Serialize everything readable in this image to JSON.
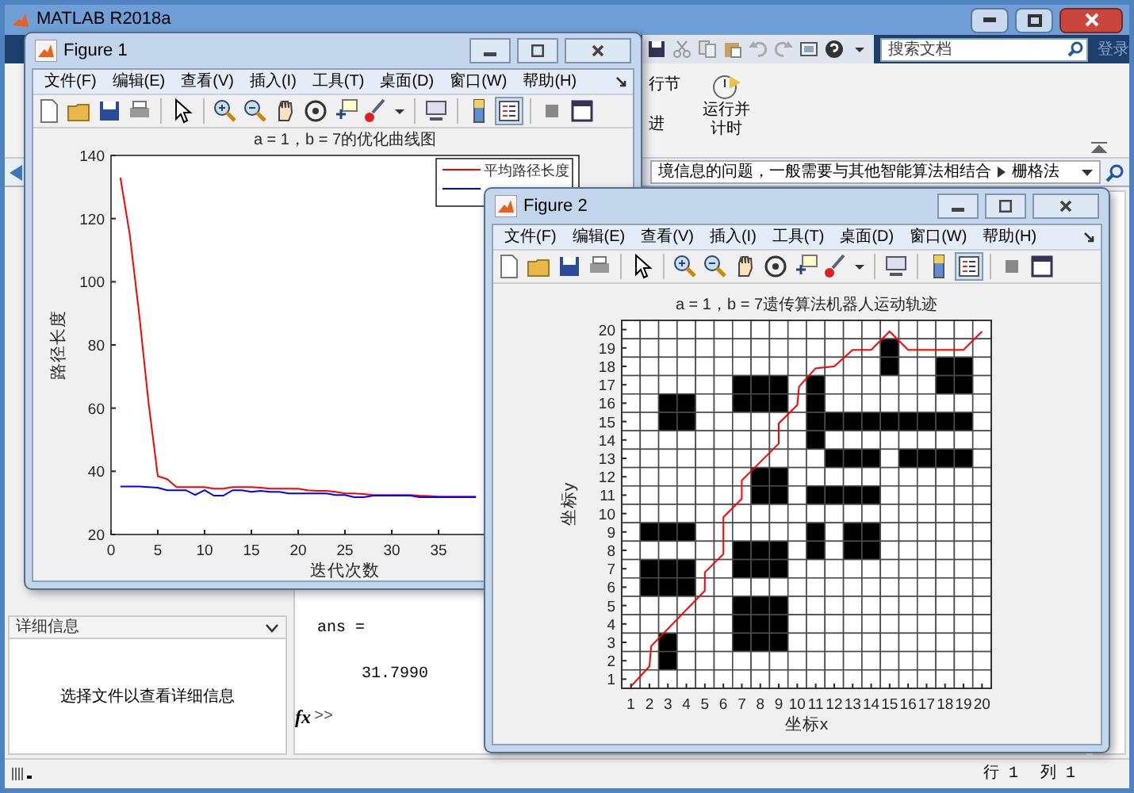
{
  "main_window": {
    "title": "MATLAB R2018a",
    "search": {
      "placeholder": "搜索文档"
    },
    "sign_in": "登录",
    "ribbon_buttons": [
      {
        "label": "行节"
      },
      {
        "label": "进"
      },
      {
        "label": "运行并计时"
      }
    ],
    "address_bar": {
      "path": "境信息的问题，一般需要与其他智能算法相结合",
      "folder": "栅格法"
    },
    "details_panel": {
      "title": "详细信息",
      "message": "选择文件以查看详细信息"
    },
    "command_window": {
      "lines": [
        "ans =",
        "31.7990"
      ],
      "fx_label": "fx",
      "prompt": ">>"
    },
    "status_bar": {
      "row": "行 1",
      "column": "列 1"
    }
  },
  "figures": [
    {
      "title": "Figure 1",
      "menu": [
        "文件(F)",
        "编辑(E)",
        "查看(V)",
        "插入(I)",
        "工具(T)",
        "桌面(D)",
        "窗口(W)",
        "帮助(H)"
      ],
      "chart_data": {
        "type": "line",
        "title": "a = 1，b = 7的优化曲线图",
        "xlabel": "迭代次数",
        "ylabel": "路径长度",
        "xlim": [
          0,
          50
        ],
        "ylim": [
          20,
          140
        ],
        "xticks": [
          0,
          5,
          10,
          15,
          20,
          25,
          30,
          35
        ],
        "yticks": [
          20,
          40,
          60,
          80,
          100,
          120,
          140
        ],
        "x": [
          1,
          2,
          3,
          4,
          5,
          6,
          7,
          8,
          9,
          10,
          11,
          12,
          13,
          14,
          15,
          16,
          17,
          18,
          19,
          20,
          21,
          22,
          23,
          24,
          25,
          26,
          27,
          28,
          29,
          30,
          31,
          32,
          33,
          34,
          35,
          36,
          37,
          38,
          39
        ],
        "series": [
          {
            "name": "平均路径长度",
            "color": "#ff0000",
            "values": [
              133,
              115,
              90,
              62,
              38.5,
              37.5,
              35,
              35,
              35,
              35,
              34.5,
              34.5,
              35,
              35,
              35,
              34.8,
              34.5,
              34.5,
              34.5,
              34.5,
              34,
              33.8,
              33.8,
              33.5,
              33,
              33,
              32.8,
              32.5,
              32.5,
              32.5,
              32.5,
              32.5,
              32.3,
              32.2,
              32,
              32,
              32,
              32,
              32
            ]
          },
          {
            "color": "#0000ff",
            "values": [
              35.2,
              35.2,
              35.2,
              35,
              34.8,
              34,
              34,
              34,
              32.5,
              34,
              32.3,
              32.3,
              34,
              34,
              33.5,
              33.8,
              33.5,
              33.5,
              33,
              33,
              33,
              33,
              33,
              32.5,
              32.5,
              31.8,
              31.8,
              32.3,
              32.3,
              32.3,
              32.3,
              32.3,
              31.8,
              31.8,
              31.8,
              31.8,
              31.8,
              31.8,
              31.8
            ]
          }
        ]
      }
    },
    {
      "title": "Figure 2",
      "menu": [
        "文件(F)",
        "编辑(E)",
        "查看(V)",
        "插入(I)",
        "工具(T)",
        "桌面(D)",
        "窗口(W)",
        "帮助(H)"
      ],
      "chart_data": {
        "type": "line",
        "title": "a = 1，b = 7遗传算法机器人运动轨迹",
        "xlabel": "坐标x",
        "ylabel": "坐标y",
        "xlim": [
          0.5,
          20.5
        ],
        "ylim": [
          0.5,
          20.5
        ],
        "xticks": [
          1,
          2,
          3,
          4,
          5,
          6,
          7,
          8,
          9,
          10,
          11,
          12,
          13,
          14,
          15,
          16,
          17,
          18,
          19,
          20
        ],
        "yticks": [
          1,
          2,
          3,
          4,
          5,
          6,
          7,
          8,
          9,
          10,
          11,
          12,
          13,
          14,
          15,
          16,
          17,
          18,
          19,
          20
        ],
        "x": [
          1,
          2,
          2.1,
          4.6,
          5,
          5,
          6,
          6,
          7,
          7,
          8,
          9,
          9,
          10,
          10.1,
          11,
          12,
          13,
          14,
          15,
          16,
          19,
          20
        ],
        "series": [
          {
            "color": "#ff0000",
            "values": [
              0.6,
              1.7,
              2.8,
              5.4,
              5.8,
              6.8,
              7.8,
              9.8,
              10.8,
              11.8,
              12.8,
              13.8,
              14.9,
              15.9,
              16.9,
              17.9,
              18,
              18.9,
              18.9,
              19.9,
              18.9,
              18.9,
              19.9
            ]
          }
        ]
      },
      "obstacle_rows": [
        [
          false,
          false,
          false,
          false,
          false,
          false,
          false,
          false,
          false,
          false,
          false,
          false,
          false,
          false,
          false,
          false,
          false,
          false,
          false,
          false
        ],
        [
          false,
          false,
          false,
          false,
          false,
          false,
          false,
          false,
          false,
          false,
          false,
          false,
          false,
          false,
          true,
          false,
          false,
          false,
          false,
          false
        ],
        [
          false,
          false,
          false,
          false,
          false,
          false,
          false,
          false,
          false,
          false,
          false,
          false,
          false,
          false,
          true,
          false,
          false,
          true,
          true,
          false
        ],
        [
          false,
          false,
          false,
          false,
          false,
          false,
          true,
          true,
          true,
          false,
          true,
          false,
          false,
          false,
          false,
          false,
          false,
          true,
          true,
          false
        ],
        [
          false,
          false,
          true,
          true,
          false,
          false,
          true,
          true,
          true,
          false,
          true,
          false,
          false,
          false,
          false,
          false,
          false,
          false,
          false,
          false
        ],
        [
          false,
          false,
          true,
          true,
          false,
          false,
          false,
          false,
          false,
          false,
          true,
          true,
          true,
          true,
          true,
          true,
          true,
          true,
          true,
          false
        ],
        [
          false,
          false,
          false,
          false,
          false,
          false,
          false,
          false,
          false,
          false,
          true,
          false,
          false,
          false,
          false,
          false,
          false,
          false,
          false,
          false
        ],
        [
          false,
          false,
          false,
          false,
          false,
          false,
          false,
          false,
          false,
          false,
          false,
          true,
          true,
          true,
          false,
          true,
          true,
          true,
          true,
          false
        ],
        [
          false,
          false,
          false,
          false,
          false,
          false,
          false,
          true,
          true,
          false,
          false,
          false,
          false,
          false,
          false,
          false,
          false,
          false,
          false,
          false
        ],
        [
          false,
          false,
          false,
          false,
          false,
          false,
          false,
          true,
          true,
          false,
          true,
          true,
          true,
          true,
          false,
          false,
          false,
          false,
          false,
          false
        ],
        [
          false,
          false,
          false,
          false,
          false,
          false,
          false,
          false,
          false,
          false,
          false,
          false,
          false,
          false,
          false,
          false,
          false,
          false,
          false,
          false
        ],
        [
          false,
          true,
          true,
          true,
          false,
          false,
          false,
          false,
          false,
          false,
          true,
          false,
          true,
          true,
          false,
          false,
          false,
          false,
          false,
          false
        ],
        [
          false,
          false,
          false,
          false,
          false,
          false,
          true,
          true,
          true,
          false,
          true,
          false,
          true,
          true,
          false,
          false,
          false,
          false,
          false,
          false
        ],
        [
          false,
          true,
          true,
          true,
          false,
          false,
          true,
          true,
          true,
          false,
          false,
          false,
          false,
          false,
          false,
          false,
          false,
          false,
          false,
          false
        ],
        [
          false,
          true,
          true,
          true,
          false,
          false,
          false,
          false,
          false,
          false,
          false,
          false,
          false,
          false,
          false,
          false,
          false,
          false,
          false,
          false
        ],
        [
          false,
          false,
          false,
          false,
          false,
          false,
          true,
          true,
          true,
          false,
          false,
          false,
          false,
          false,
          false,
          false,
          false,
          false,
          false,
          false
        ],
        [
          false,
          false,
          false,
          false,
          false,
          false,
          true,
          true,
          true,
          false,
          false,
          false,
          false,
          false,
          false,
          false,
          false,
          false,
          false,
          false
        ],
        [
          false,
          false,
          true,
          false,
          false,
          false,
          true,
          true,
          true,
          false,
          false,
          false,
          false,
          false,
          false,
          false,
          false,
          false,
          false,
          false
        ],
        [
          false,
          false,
          true,
          false,
          false,
          false,
          false,
          false,
          false,
          false,
          false,
          false,
          false,
          false,
          false,
          false,
          false,
          false,
          false,
          false
        ],
        [
          false,
          false,
          false,
          false,
          false,
          false,
          false,
          false,
          false,
          false,
          false,
          false,
          false,
          false,
          false,
          false,
          false,
          false,
          false,
          false
        ]
      ]
    }
  ]
}
